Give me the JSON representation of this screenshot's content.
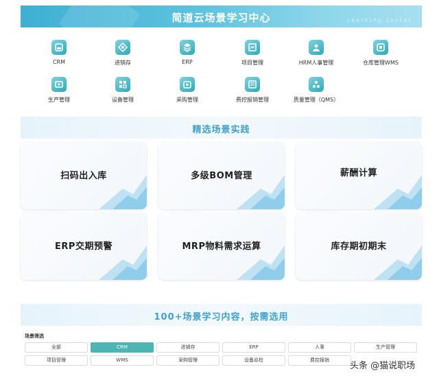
{
  "banner": {
    "title": "简道云场景学习中心",
    "subtitle": "Learning Center"
  },
  "modules": [
    {
      "label": "CRM",
      "icon": "crm-icon"
    },
    {
      "label": "进销存",
      "icon": "inventory-icon"
    },
    {
      "label": "ERP",
      "icon": "erp-icon"
    },
    {
      "label": "项目管理",
      "icon": "project-icon"
    },
    {
      "label": "HRM人事管理",
      "icon": "hrm-icon"
    },
    {
      "label": "仓库管理WMS",
      "icon": "warehouse-icon"
    },
    {
      "label": "生产管理",
      "icon": "production-icon"
    },
    {
      "label": "设备管理",
      "icon": "equipment-icon"
    },
    {
      "label": "采购管理",
      "icon": "purchase-icon"
    },
    {
      "label": "费控报销管理",
      "icon": "expense-icon"
    },
    {
      "label": "质量管理（QMS）",
      "icon": "quality-icon"
    }
  ],
  "practice": {
    "title": "精选场景实践",
    "cards": [
      "扫码出入库",
      "多级BOM管理",
      "薪酬计算",
      "ERP交期预警",
      "MRP物料需求运算",
      "库存期初期末"
    ]
  },
  "library": {
    "title": "100+场景学习内容，按需选用",
    "filter_label": "场景筛选",
    "chips": [
      "全部",
      "CRM",
      "进销存",
      "ERP",
      "人事",
      "生产管理",
      "项目管理",
      "WMS",
      "采购管理",
      "设备巡检",
      "费控报销"
    ],
    "active_chip": "CRM"
  },
  "watermark": "头条 @猫说职场",
  "colors": {
    "accent": "#4db5b3",
    "banner": "#3fb0d2",
    "section_title": "#3fa2cf"
  }
}
